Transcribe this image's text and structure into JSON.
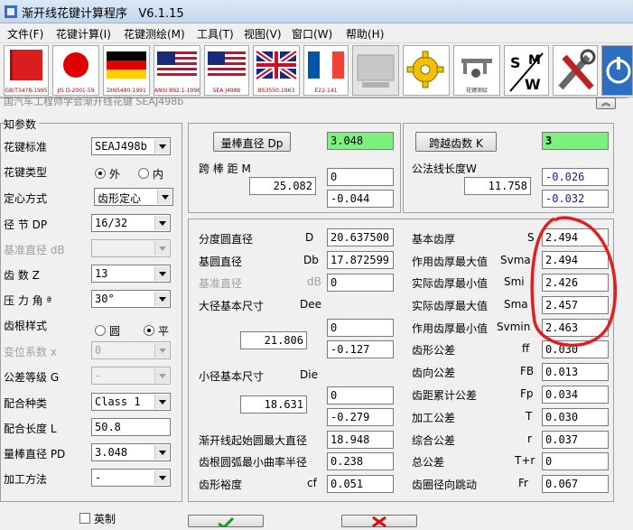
{
  "window": {
    "title": "渐开线花键计算程序   V6.1.15"
  },
  "menu": [
    "文件(F)",
    "花键计算(I)",
    "花键测绘(M)",
    "工具(T)",
    "视图(V)",
    "窗口(W)",
    "帮助(H)"
  ],
  "toolbar": [
    {
      "name": "gb-t3478-1995-button",
      "label": "GB/T3478-1995",
      "icon": "china-flag-icon"
    },
    {
      "name": "jis-d2001-59-button",
      "label": "JIS D-2001-59",
      "icon": "japan-flag-icon"
    },
    {
      "name": "din5480-1991-button",
      "label": "DIN5480-1991",
      "icon": "germany-flag-icon"
    },
    {
      "name": "ansi-b92-1-button",
      "label": "ANSI B92.1-1996",
      "icon": "usa-flag-icon"
    },
    {
      "name": "sea-j498b-button",
      "label": "SEA J498b",
      "icon": "usa-flag-icon"
    },
    {
      "name": "bs3550-1963-button",
      "label": "BS3550-1963",
      "icon": "uk-flag-icon"
    },
    {
      "name": "e22-141-button",
      "label": "E22-141",
      "icon": "france-flag-icon"
    },
    {
      "name": "blank-tool-button",
      "label": "",
      "icon": "blank-icon"
    },
    {
      "name": "gear-tool-button",
      "label": "",
      "icon": "gear-icon"
    },
    {
      "name": "measure-tool-button",
      "label": "花键测绘",
      "icon": "caliper-icon"
    },
    {
      "name": "sm-tool-button",
      "label": "",
      "icon": "sm-icon"
    },
    {
      "name": "tools-button",
      "label": "",
      "icon": "tools-icon"
    },
    {
      "name": "power-button",
      "label": "",
      "icon": "power-icon"
    }
  ],
  "panel_header": "国汽车工程师学会渐开线花键  SEAJ498b",
  "params": {
    "group_title": "知参数",
    "standard_label": "花键标准",
    "standard_value": "SEAJ498b",
    "type_label": "花键类型",
    "type_ext": "外",
    "type_int": "内",
    "center_label": "定心方式",
    "center_value": "齿形定心",
    "pitch_label": "径  节     DP",
    "pitch_value": "16/32",
    "basedia_label": "基准直径 dB",
    "basedia_value": "",
    "teeth_label": "齿     数  Z",
    "teeth_value": "13",
    "angle_label": "压 力 角  ª",
    "angle_value": "30°",
    "root_label": "齿根样式",
    "root_round": "圆",
    "root_flat": "平",
    "shift_label": "变位系数   x",
    "shift_value": "0",
    "tol_label": "公差等级  G",
    "tol_value": "-",
    "fit_label": "配合种类",
    "fit_value": "Class 1",
    "length_label": "配合长度  L",
    "length_value": "50.8",
    "rod_label": "量棒直径 PD",
    "rod_value": "3.048",
    "method_label": "加工方法",
    "method_value": "-",
    "metric_label": "英制"
  },
  "rodbox": {
    "rod_btn": "量棒直径 Dp",
    "rod_val": "3.048",
    "dist_label": "跨 棒 距   M",
    "dist_top": "0",
    "dist_main": "25.082",
    "dist_bot": "-0.044"
  },
  "spanbox": {
    "span_btn": "跨越齿数  K",
    "span_val": "3",
    "wlen_label": "公法线长度W",
    "w_main": "11.758",
    "w_top": "-0.026",
    "w_bot": "-0.032"
  },
  "geom": {
    "pitchdia_label": "分度圆直径",
    "pitchdia_sym": "D",
    "pitchdia_val": "20.637500",
    "basecircle_label": "基圆直径",
    "basecircle_sym": "Db",
    "basecircle_val": "17.872599",
    "refdia_label": "基准直径",
    "refdia_sym": "dB",
    "refdia_val": "0",
    "major_label": "大径基本尺寸",
    "major_sym": "Dee",
    "major_top": "0",
    "major_main": "21.806",
    "major_bot": "-0.127",
    "minor_label": "小径基本尺寸",
    "minor_sym": "Die",
    "minor_top": "0",
    "minor_main": "18.631",
    "minor_bot": "-0.279",
    "involute_label": "渐开线起始圆最大直径",
    "involute_val": "18.948",
    "fillet_label": "齿根圆弧最小曲率半径",
    "fillet_val": "0.238",
    "clear_label": "齿形裕度",
    "clear_sym": "cf",
    "clear_val": "0.051"
  },
  "tooth": {
    "basic_label": "基本齿厚",
    "basic_sym": "S",
    "basic_val": "2.494",
    "effmax_label": "作用齿厚最大值",
    "effmax_sym": "Svma",
    "effmax_val": "2.494",
    "actmin_label": "实际齿厚最小值",
    "actmin_sym": "Smi",
    "actmin_val": "2.426",
    "actmax_label": "实际齿厚最大值",
    "actmax_sym": "Sma",
    "actmax_val": "2.457",
    "effmin_label": "作用齿厚最小值",
    "effmin_sym": "Svmin",
    "effmin_val": "2.463",
    "ff_label": "齿形公差",
    "ff_sym": "ff",
    "ff_val": "0.030",
    "fb_label": "齿向公差",
    "fb_sym": "FB",
    "fb_val": "0.013",
    "fp_label": "齿距累计公差",
    "fp_sym": "Fp",
    "fp_val": "0.034",
    "t_label": "加工公差",
    "t_sym": "T",
    "t_val": "0.030",
    "r_label": "综合公差",
    "r_sym": "r",
    "r_val": "0.037",
    "tr_label": "总公差",
    "tr_sym": "T+r",
    "tr_val": "0",
    "fr_label": "齿圈径向跳动",
    "fr_sym": "Fr",
    "fr_val": "0.067"
  }
}
